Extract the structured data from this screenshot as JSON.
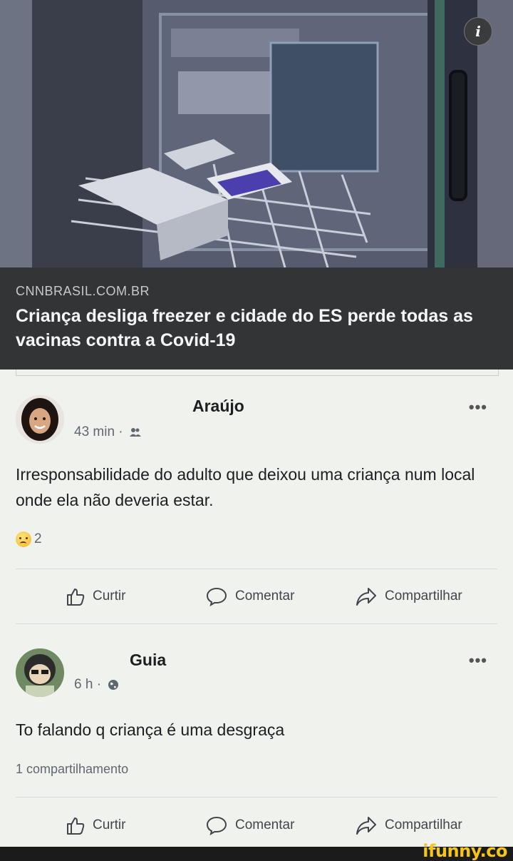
{
  "link_preview": {
    "domain": "CNNBRASIL.COM.BR",
    "title": "Criança desliga freezer e cidade do ES perde todas as vacinas contra a Covid-19",
    "info_label": "i"
  },
  "posts": [
    {
      "author": "Araújo",
      "time": "43 min ·",
      "audience_icon": "friends-icon",
      "text": "Irresponsabilidade do adulto que deixou uma criança num local onde ela não deveria estar.",
      "reaction_count": "2",
      "actions": {
        "like": "Curtir",
        "comment": "Comentar",
        "share": "Compartilhar"
      }
    },
    {
      "author": "Guia",
      "time": "6 h ·",
      "audience_icon": "globe-icon",
      "text": "To falando q criança é uma desgraça",
      "share_count": "1 compartilhamento",
      "actions": {
        "like": "Curtir",
        "comment": "Comentar",
        "share": "Compartilhar"
      }
    }
  ],
  "more_label": "•••",
  "brand": "ifunny.co",
  "colors": {
    "background": "#f0f2ee",
    "caption_bar": "#323436",
    "brand_yellow": "#f5c518"
  }
}
